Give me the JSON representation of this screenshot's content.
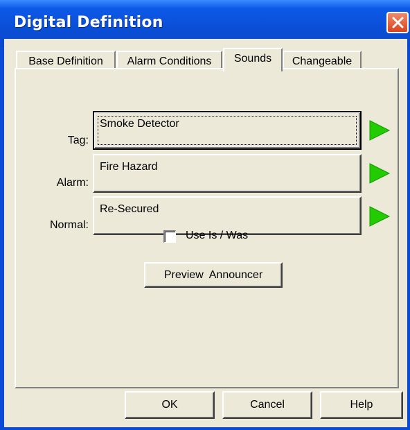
{
  "window": {
    "title": "Digital Definition"
  },
  "tabs": [
    {
      "label": "Base Definition",
      "active": false
    },
    {
      "label": "Alarm Conditions",
      "active": false
    },
    {
      "label": "Sounds",
      "active": true
    },
    {
      "label": "Changeable",
      "active": false
    }
  ],
  "sounds": {
    "tag": {
      "label": "Tag:",
      "value": "Smoke Detector"
    },
    "alarm": {
      "label": "Alarm:",
      "value": "Fire Hazard"
    },
    "normal": {
      "label": "Normal:",
      "value": "Re-Secured"
    }
  },
  "use_is_was": {
    "label": "Use Is / Was",
    "checked": false
  },
  "preview_label": "Preview  Announcer",
  "buttons": {
    "ok": "OK",
    "cancel": "Cancel",
    "help": "Help"
  },
  "colors": {
    "title_bar": "#0a4fd8",
    "dialog_face": "#ece9d8",
    "play_icon": "#22cc00",
    "close_button": "#d9421e"
  },
  "icons": {
    "close": "close-icon",
    "play": "play-icon"
  }
}
